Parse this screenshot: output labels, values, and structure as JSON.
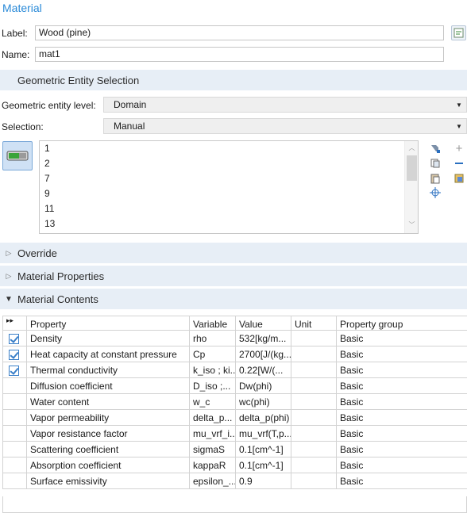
{
  "title": "Material",
  "label_field": {
    "label": "Label:",
    "value": "Wood (pine)"
  },
  "name_field": {
    "label": "Name:",
    "value": "mat1"
  },
  "sections": {
    "geometric": "Geometric Entity Selection",
    "override": "Override",
    "material_properties": "Material Properties",
    "material_contents": "Material Contents"
  },
  "entity_level": {
    "label": "Geometric entity level:",
    "value": "Domain"
  },
  "selection": {
    "label": "Selection:",
    "value": "Manual"
  },
  "selection_list": [
    "1",
    "2",
    "7",
    "9",
    "11",
    "13"
  ],
  "table": {
    "expand_glyph": "▸▸",
    "headers": [
      "Property",
      "Variable",
      "Value",
      "Unit",
      "Property group"
    ],
    "rows": [
      {
        "checked": true,
        "property": "Density",
        "variable": "rho",
        "value": "532[kg/m...",
        "unit": "",
        "group": "Basic"
      },
      {
        "checked": true,
        "property": "Heat capacity at constant pressure",
        "variable": "Cp",
        "value": "2700[J/(kg...",
        "unit": "",
        "group": "Basic"
      },
      {
        "checked": true,
        "property": "Thermal conductivity",
        "variable": "k_iso ; ki...",
        "value": "0.22[W/(...",
        "unit": "",
        "group": "Basic"
      },
      {
        "checked": false,
        "property": "Diffusion coefficient",
        "variable": "D_iso ;...",
        "value": "Dw(phi)",
        "unit": "",
        "group": "Basic"
      },
      {
        "checked": false,
        "property": "Water content",
        "variable": "w_c",
        "value": "wc(phi)",
        "unit": "",
        "group": "Basic"
      },
      {
        "checked": false,
        "property": "Vapor permeability",
        "variable": "delta_p...",
        "value": "delta_p(phi)",
        "unit": "",
        "group": "Basic"
      },
      {
        "checked": false,
        "property": "Vapor resistance factor",
        "variable": "mu_vrf_i...",
        "value": "mu_vrf(T,p...",
        "unit": "",
        "group": "Basic"
      },
      {
        "checked": false,
        "property": "Scattering coefficient",
        "variable": "sigmaS",
        "value": "0.1[cm^-1]",
        "unit": "",
        "group": "Basic"
      },
      {
        "checked": false,
        "property": "Absorption coefficient",
        "variable": "kappaR",
        "value": "0.1[cm^-1]",
        "unit": "",
        "group": "Basic"
      },
      {
        "checked": false,
        "property": "Surface emissivity",
        "variable": "epsilon_...",
        "value": "0.9",
        "unit": "",
        "group": "Basic"
      }
    ]
  },
  "colors": {
    "accent": "#2a8ad8",
    "section_bg": "#e7eef6"
  }
}
